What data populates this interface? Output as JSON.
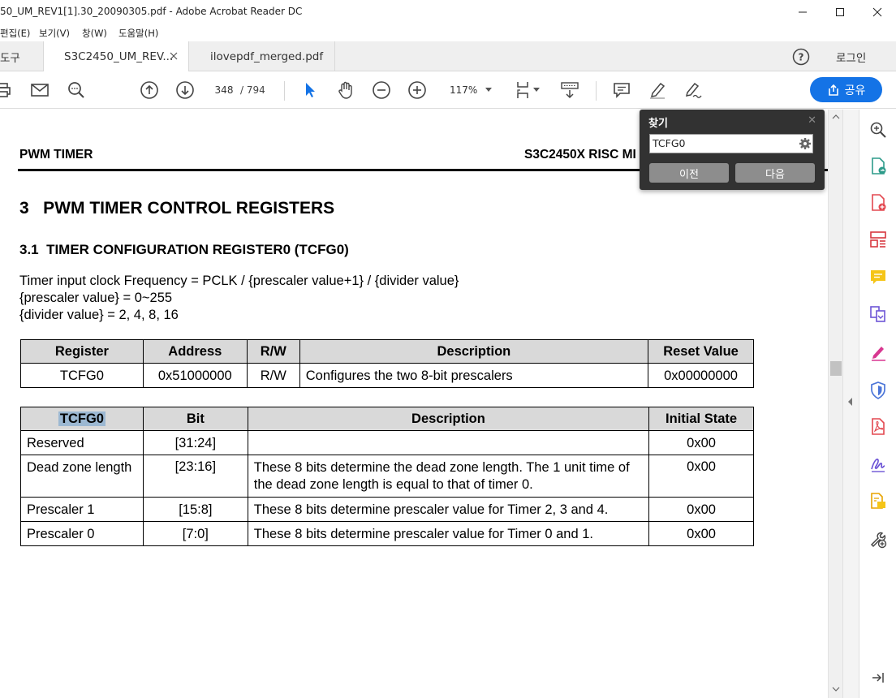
{
  "window": {
    "title": "50_UM_REV1[1].30_20090305.pdf - Adobe Acrobat Reader DC"
  },
  "menu": [
    "편집(E)",
    "보기(V)",
    "창(W)",
    "도움말(H)"
  ],
  "tabs": {
    "tools_label": "도구",
    "items": [
      {
        "label": "S3C2450_UM_REV...",
        "active": true
      },
      {
        "label": "ilovepdf_merged.pdf",
        "active": false
      }
    ],
    "login_label": "로그인"
  },
  "toolbar": {
    "current_page": "348",
    "page_sep": "/ 794",
    "zoom": "117%",
    "share_label": "공유"
  },
  "find": {
    "title": "찾기",
    "query": "TCFG0",
    "prev_label": "이전",
    "next_label": "다음"
  },
  "document": {
    "header_left": "PWM TIMER",
    "header_right": "S3C2450X RISC MI",
    "section_heading": "3   PWM TIMER CONTROL REGISTERS",
    "subsection_heading": "3.1  TIMER CONFIGURATION REGISTER0 (TCFG0)",
    "lines": [
      "Timer input clock Frequency = PCLK / {prescaler value+1} / {divider value}",
      "{prescaler value} = 0~255",
      "{divider value} = 2, 4, 8, 16"
    ],
    "register_table": {
      "headers": [
        "Register",
        "Address",
        "R/W",
        "Description",
        "Reset Value"
      ],
      "row": [
        "TCFG0",
        "0x51000000",
        "R/W",
        "Configures the two 8-bit prescalers",
        "0x00000000"
      ]
    },
    "bit_table": {
      "headers": [
        "TCFG0",
        "Bit",
        "Description",
        "Initial State"
      ],
      "rows": [
        {
          "name": "Reserved",
          "bit": "[31:24]",
          "desc": "",
          "init": "0x00"
        },
        {
          "name": "Dead zone length",
          "bit": "[23:16]",
          "desc": "These 8 bits determine the dead zone length. The 1 unit time of the dead zone length is equal to that of timer 0.",
          "init": "0x00"
        },
        {
          "name": "Prescaler 1",
          "bit": "[15:8]",
          "desc": "These 8 bits determine prescaler value for Timer 2, 3 and 4.",
          "init": "0x00"
        },
        {
          "name": "Prescaler 0",
          "bit": "[7:0]",
          "desc": "These 8 bits determine prescaler value for Timer 0 and 1.",
          "init": "0x00"
        }
      ]
    }
  },
  "colors": {
    "accent": "#1473e6",
    "search_highlight": "#9cb8d2",
    "find_panel": "#323232"
  }
}
